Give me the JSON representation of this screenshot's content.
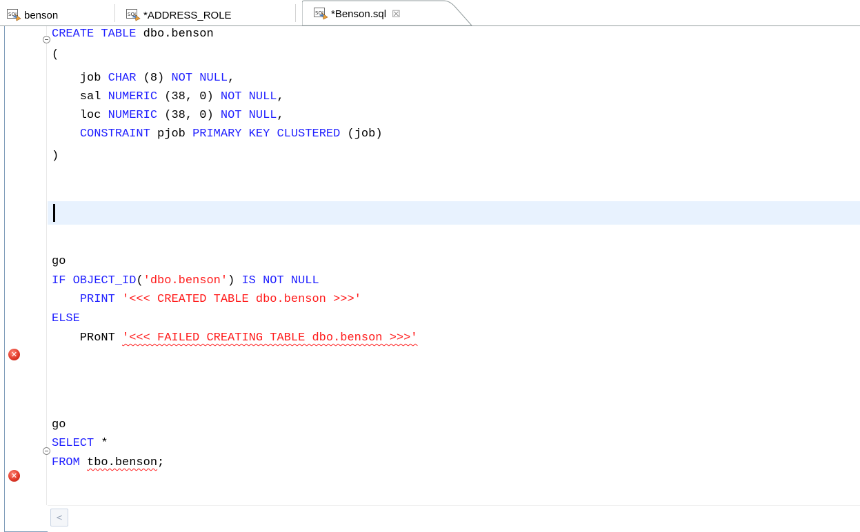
{
  "tabs": [
    {
      "label": "benson",
      "icon": "sql-file-icon",
      "active": false
    },
    {
      "label": "*ADDRESS_ROLE",
      "icon": "sql-file-icon",
      "active": false
    },
    {
      "label": "*Benson.sql",
      "icon": "sql-file-icon",
      "active": true,
      "close_glyph": "☒"
    }
  ],
  "editor": {
    "lines": [
      {
        "tokens": [
          {
            "t": "CREATE TABLE",
            "c": "kw"
          },
          {
            "t": " dbo.benson",
            "c": ""
          }
        ]
      },
      {
        "tokens": [
          {
            "t": "(",
            "c": ""
          }
        ]
      },
      {
        "tokens": [
          {
            "t": "    job ",
            "c": ""
          },
          {
            "t": "CHAR",
            "c": "kw"
          },
          {
            "t": " (8) ",
            "c": ""
          },
          {
            "t": "NOT NULL",
            "c": "kw"
          },
          {
            "t": ",",
            "c": ""
          }
        ]
      },
      {
        "tokens": [
          {
            "t": "    sal ",
            "c": ""
          },
          {
            "t": "NUMERIC",
            "c": "kw"
          },
          {
            "t": " (38, 0) ",
            "c": ""
          },
          {
            "t": "NOT NULL",
            "c": "kw"
          },
          {
            "t": ",",
            "c": ""
          }
        ]
      },
      {
        "tokens": [
          {
            "t": "    loc ",
            "c": ""
          },
          {
            "t": "NUMERIC",
            "c": "kw"
          },
          {
            "t": " (38, 0) ",
            "c": ""
          },
          {
            "t": "NOT NULL",
            "c": "kw"
          },
          {
            "t": ",",
            "c": ""
          }
        ]
      },
      {
        "tokens": [
          {
            "t": "    ",
            "c": ""
          },
          {
            "t": "CONSTRAINT",
            "c": "kw"
          },
          {
            "t": " pjob ",
            "c": ""
          },
          {
            "t": "PRIMARY KEY CLUSTERED",
            "c": "kw"
          },
          {
            "t": " (job)",
            "c": ""
          }
        ]
      },
      {
        "tokens": [
          {
            "t": ")",
            "c": ""
          }
        ]
      },
      {
        "tokens": [
          {
            "t": "go",
            "c": ""
          }
        ]
      },
      {
        "tokens": [
          {
            "t": "IF",
            "c": "kw"
          },
          {
            "t": " ",
            "c": ""
          },
          {
            "t": "OBJECT_ID",
            "c": "kw"
          },
          {
            "t": "(",
            "c": ""
          },
          {
            "t": "'dbo.benson'",
            "c": "str"
          },
          {
            "t": ") ",
            "c": ""
          },
          {
            "t": "IS NOT NULL",
            "c": "kw"
          }
        ]
      },
      {
        "tokens": [
          {
            "t": "    ",
            "c": ""
          },
          {
            "t": "PRINT",
            "c": "kw"
          },
          {
            "t": " ",
            "c": ""
          },
          {
            "t": "'<<< CREATED TABLE dbo.benson >>>'",
            "c": "str"
          }
        ]
      },
      {
        "tokens": [
          {
            "t": "ELSE",
            "c": "kw"
          }
        ]
      },
      {
        "tokens": [
          {
            "t": "    PRoNT ",
            "c": ""
          },
          {
            "t": "'<<< FAILED CREATING TABLE dbo.benson >>>'",
            "c": "str err"
          }
        ]
      },
      {
        "tokens": [
          {
            "t": "go",
            "c": ""
          }
        ]
      },
      {
        "tokens": [
          {
            "t": "SELECT",
            "c": "kw"
          },
          {
            "t": " *",
            "c": ""
          }
        ]
      },
      {
        "tokens": [
          {
            "t": "FROM",
            "c": "kw"
          },
          {
            "t": " ",
            "c": ""
          },
          {
            "t": "tbo.benson",
            "c": "err"
          },
          {
            "t": ";",
            "c": ""
          }
        ]
      }
    ],
    "error_marker_glyph": "✕",
    "scroll_left_glyph": "<"
  }
}
